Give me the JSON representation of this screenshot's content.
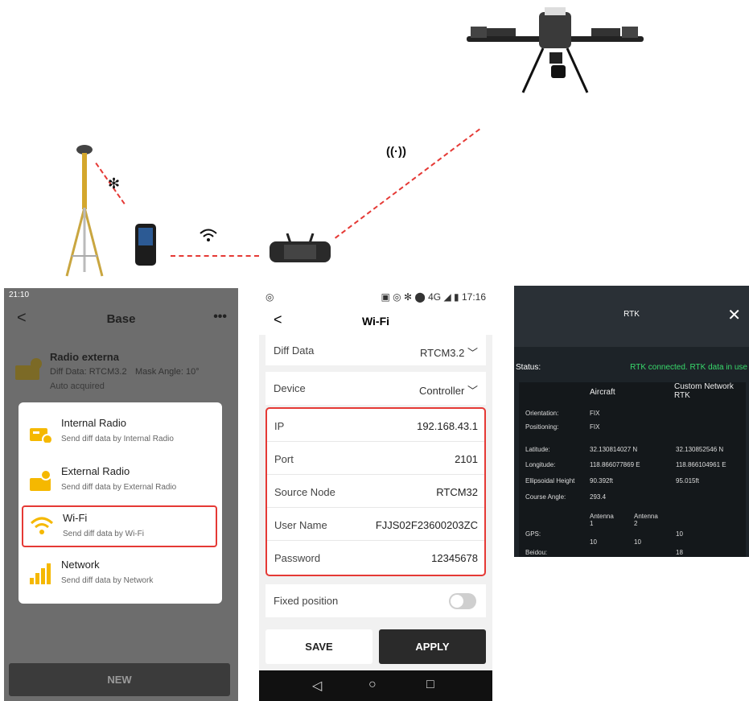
{
  "diagram": {
    "bluetooth_glyph": "✻",
    "signal_glyph": "((·))",
    "wifi_glyph": "wifi-icon"
  },
  "base_screen": {
    "status_time": "21:10",
    "title": "Base",
    "back": "<",
    "more": "•••",
    "radio": {
      "name": "Radio externa",
      "diff": "Diff Data: RTCM3.2",
      "mask": "Mask Angle: 10°",
      "acquired": "Auto acquired"
    },
    "menu": [
      {
        "label": "Internal Radio",
        "sub": "Send diff data by Internal Radio"
      },
      {
        "label": "External Radio",
        "sub": "Send diff data by External Radio"
      },
      {
        "label": "Wi-Fi",
        "sub": "Send diff data by Wi-Fi"
      },
      {
        "label": "Network",
        "sub": "Send diff data by Network"
      }
    ],
    "new_button": "NEW"
  },
  "wifi_screen": {
    "status_time": "17:16",
    "status_icons": "▣ ◎ ✻ ⬤ 4G ◢ ▮",
    "title": "Wi-Fi",
    "back": "<",
    "diff_label": "Diff Data",
    "diff_value": "RTCM3.2",
    "device_label": "Device",
    "device_value": "Controller",
    "fields": [
      {
        "k": "IP",
        "v": "192.168.43.1"
      },
      {
        "k": "Port",
        "v": "2101"
      },
      {
        "k": "Source Node",
        "v": "RTCM32"
      },
      {
        "k": "User Name",
        "v": "FJJS02F23600203ZC"
      },
      {
        "k": "Password",
        "v": "12345678"
      }
    ],
    "fixed_label": "Fixed position",
    "fixed_on": false,
    "save": "SAVE",
    "apply": "APPLY",
    "nav": [
      "◁",
      "○",
      "□"
    ]
  },
  "rtk_screen": {
    "title": "RTK",
    "close": "✕",
    "status_label": "Status:",
    "status_value": "RTK connected. RTK data in use",
    "col_aircraft": "Aircraft",
    "col_network": "Custom Network RTK",
    "rows": [
      {
        "k": "Orientation:",
        "a": "FIX",
        "n": ""
      },
      {
        "k": "Positioning:",
        "a": "FIX",
        "n": ""
      },
      {
        "k": "Latitude:",
        "a": "32.130814027 N",
        "n": "32.130852546 N"
      },
      {
        "k": "Longitude:",
        "a": "118.866077869 E",
        "n": "118.866104961 E"
      },
      {
        "k": "Ellipsoidal Height",
        "a": "90.392ft",
        "n": "95.015ft"
      },
      {
        "k": "Course Angle:",
        "a": "293.4",
        "n": ""
      }
    ],
    "antenna1": "Antenna 1",
    "antenna2": "Antenna 2",
    "gps_label": "GPS:",
    "gps_a1": "10",
    "gps_a2": "10",
    "gps_n": "10",
    "beidou_label": "Beidou:",
    "beidou_n": "18"
  },
  "colors": {
    "accent_red": "#e53935",
    "rtk_green": "#38d96b",
    "icon_yellow": "#f5b800"
  }
}
